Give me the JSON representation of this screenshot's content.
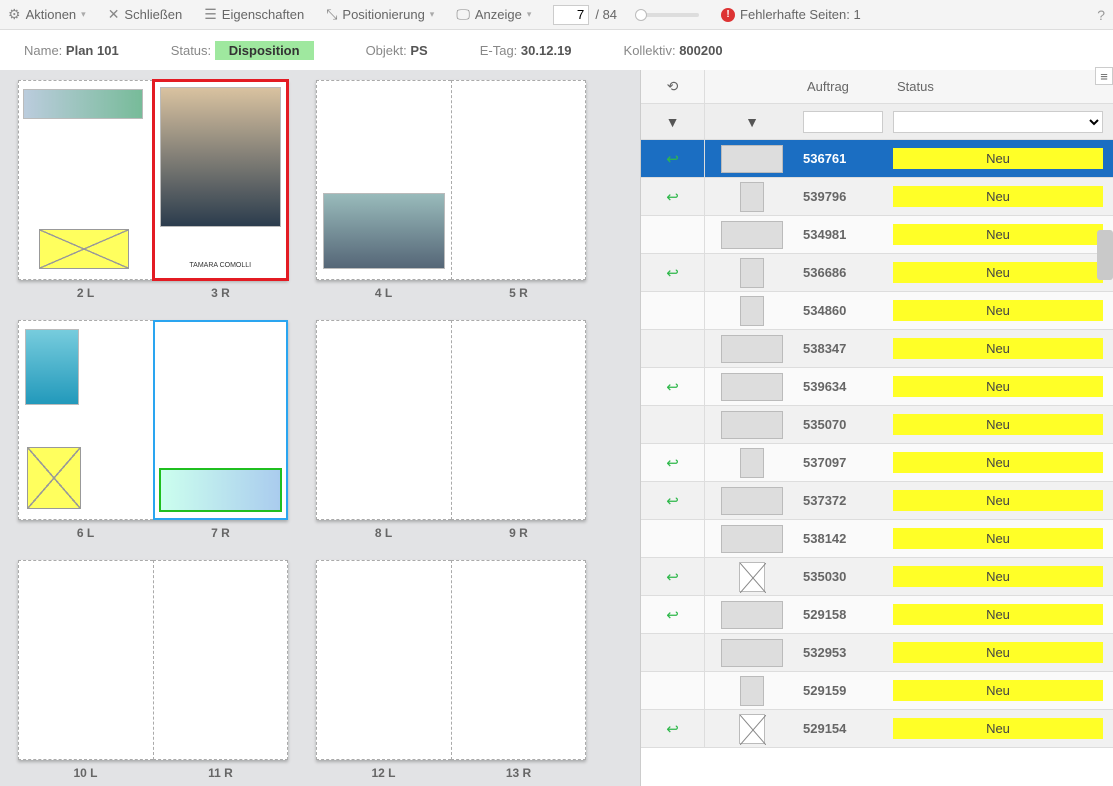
{
  "toolbar": {
    "aktionen": "Aktionen",
    "schliessen": "Schließen",
    "eigenschaften": "Eigenschaften",
    "positionierung": "Positionierung",
    "anzeige": "Anzeige",
    "current_page": "7",
    "total_pages": "/ 84",
    "error_label": "Fehlerhafte Seiten: 1"
  },
  "infobar": {
    "name_lbl": "Name:",
    "name_val": "Plan 101",
    "status_lbl": "Status:",
    "status_val": "Disposition",
    "objekt_lbl": "Objekt:",
    "objekt_val": "PS",
    "etag_lbl": "E-Tag:",
    "etag_val": "30.12.19",
    "kollektiv_lbl": "Kollektiv:",
    "kollektiv_val": "800200"
  },
  "spreads": [
    {
      "left": "2 L",
      "right": "3 R"
    },
    {
      "left": "4 L",
      "right": "5 R"
    },
    {
      "left": "6 L",
      "right": "7 R"
    },
    {
      "left": "8 L",
      "right": "9 R"
    },
    {
      "left": "10 L",
      "right": "11 R"
    },
    {
      "left": "12 L",
      "right": "13 R"
    }
  ],
  "grid": {
    "header_auftrag": "Auftrag",
    "header_status": "Status",
    "rows": [
      {
        "reply": true,
        "auftrag": "536761",
        "status": "Neu",
        "selected": true,
        "thumb": "wide"
      },
      {
        "reply": true,
        "auftrag": "539796",
        "status": "Neu",
        "thumb": "tall"
      },
      {
        "reply": false,
        "auftrag": "534981",
        "status": "Neu",
        "thumb": "wide"
      },
      {
        "reply": true,
        "auftrag": "536686",
        "status": "Neu",
        "thumb": "tall"
      },
      {
        "reply": false,
        "auftrag": "534860",
        "status": "Neu",
        "thumb": "tall"
      },
      {
        "reply": false,
        "auftrag": "538347",
        "status": "Neu",
        "thumb": "wide"
      },
      {
        "reply": true,
        "auftrag": "539634",
        "status": "Neu",
        "thumb": "wide"
      },
      {
        "reply": false,
        "auftrag": "535070",
        "status": "Neu",
        "thumb": "wide"
      },
      {
        "reply": true,
        "auftrag": "537097",
        "status": "Neu",
        "thumb": "tall"
      },
      {
        "reply": true,
        "auftrag": "537372",
        "status": "Neu",
        "thumb": "wide"
      },
      {
        "reply": false,
        "auftrag": "538142",
        "status": "Neu",
        "thumb": "wide"
      },
      {
        "reply": true,
        "auftrag": "535030",
        "status": "Neu",
        "thumb": "x"
      },
      {
        "reply": true,
        "auftrag": "529158",
        "status": "Neu",
        "thumb": "wide"
      },
      {
        "reply": false,
        "auftrag": "532953",
        "status": "Neu",
        "thumb": "wide"
      },
      {
        "reply": false,
        "auftrag": "529159",
        "status": "Neu",
        "thumb": "tall"
      },
      {
        "reply": true,
        "auftrag": "529154",
        "status": "Neu",
        "thumb": "x"
      }
    ]
  }
}
